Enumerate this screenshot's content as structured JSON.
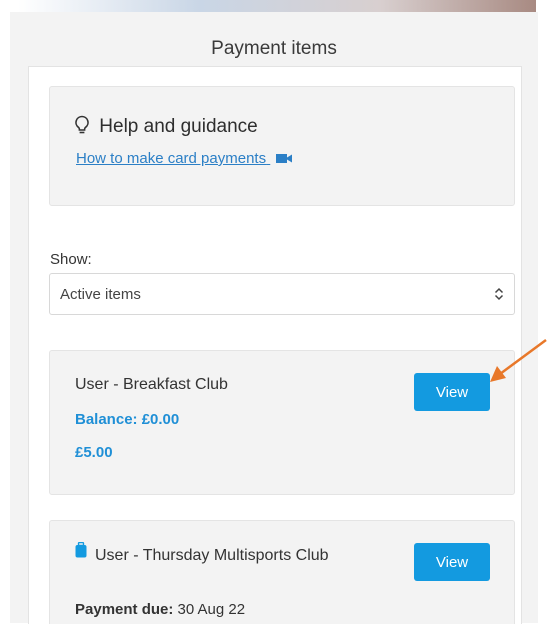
{
  "page": {
    "title": "Payment items"
  },
  "help": {
    "title": "Help and guidance",
    "link_text": "How to make card payments",
    "icon": "lightbulb-icon",
    "link_icon": "video-camera-icon"
  },
  "filter": {
    "label": "Show:",
    "selected": "Active items"
  },
  "items": [
    {
      "name": "User - Breakfast Club",
      "balance": "Balance: £0.00",
      "amount": "£5.00",
      "button": "View"
    },
    {
      "name": "User - Thursday Multisports Club",
      "due_label": "Payment due:",
      "due_date": "30 Aug 22",
      "button": "View",
      "icon": "bag-icon"
    }
  ],
  "colors": {
    "accent": "#139ae0",
    "link": "#2b7fc6",
    "annotation_arrow": "#e8782a"
  }
}
